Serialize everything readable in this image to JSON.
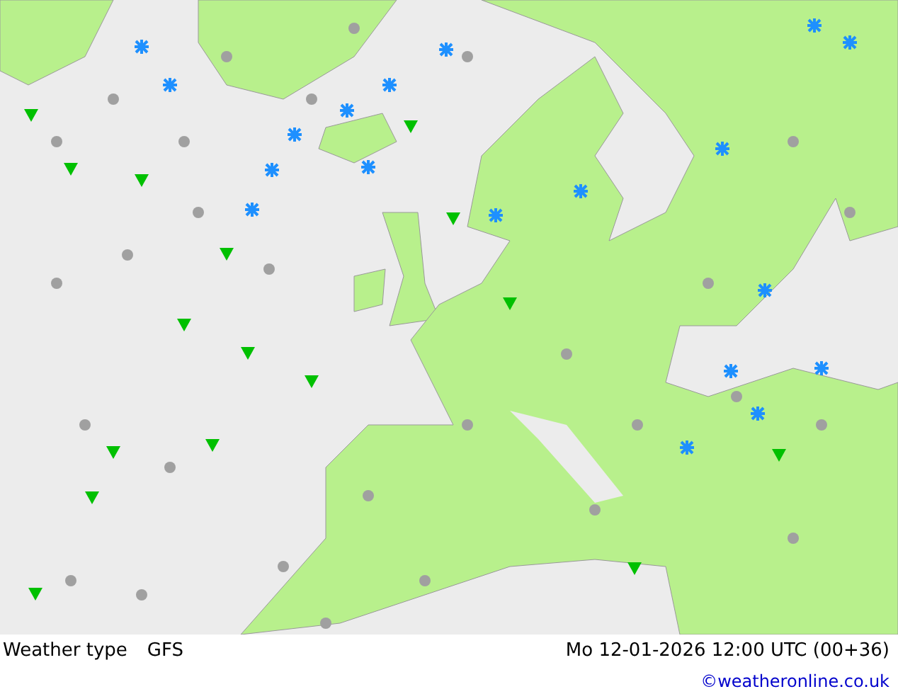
{
  "map": {
    "title": "Weather type",
    "model": "GFS",
    "valid_time": "Mo 12-01-2026 12:00 UTC (00+36)",
    "credit": "©weatheronline.co.uk"
  }
}
